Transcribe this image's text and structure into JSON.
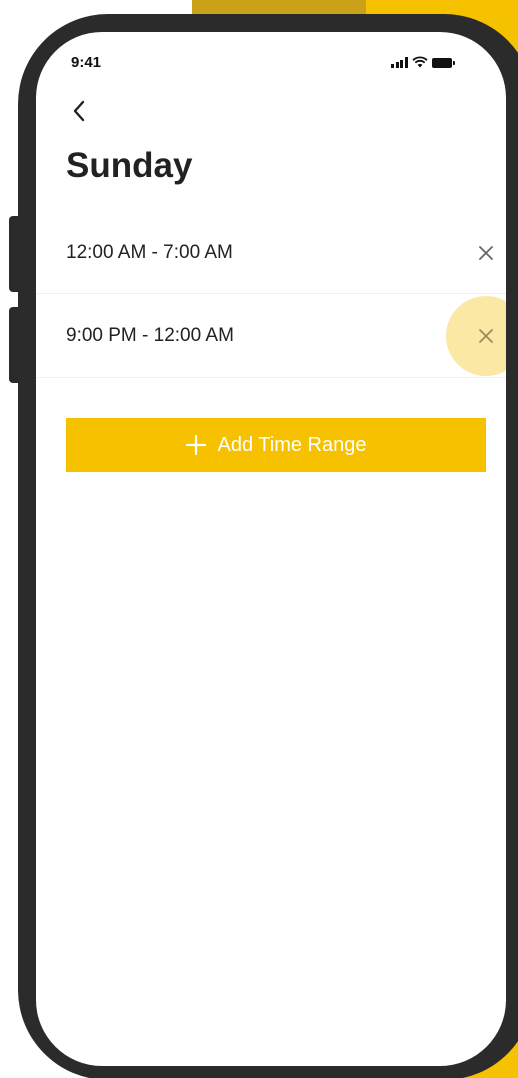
{
  "status_bar": {
    "time": "9:41",
    "icons": [
      "signal-icon",
      "wifi-icon",
      "battery-icon"
    ]
  },
  "nav": {
    "back_icon": "chevron-left-icon"
  },
  "page": {
    "title": "Sunday"
  },
  "time_ranges": [
    {
      "label": "12:00 AM - 7:00 AM",
      "remove_icon": "close-icon"
    },
    {
      "label": "9:00 PM - 12:00 AM",
      "remove_icon": "close-icon",
      "pressed": true
    }
  ],
  "actions": {
    "add_label": "Add Time Range",
    "add_icon": "plus-icon"
  },
  "colors": {
    "accent": "#F6C200",
    "accent_dark": "#C9A21A",
    "phone_frame": "#2B2B2B",
    "text": "#222222",
    "icon_muted": "#777777"
  }
}
